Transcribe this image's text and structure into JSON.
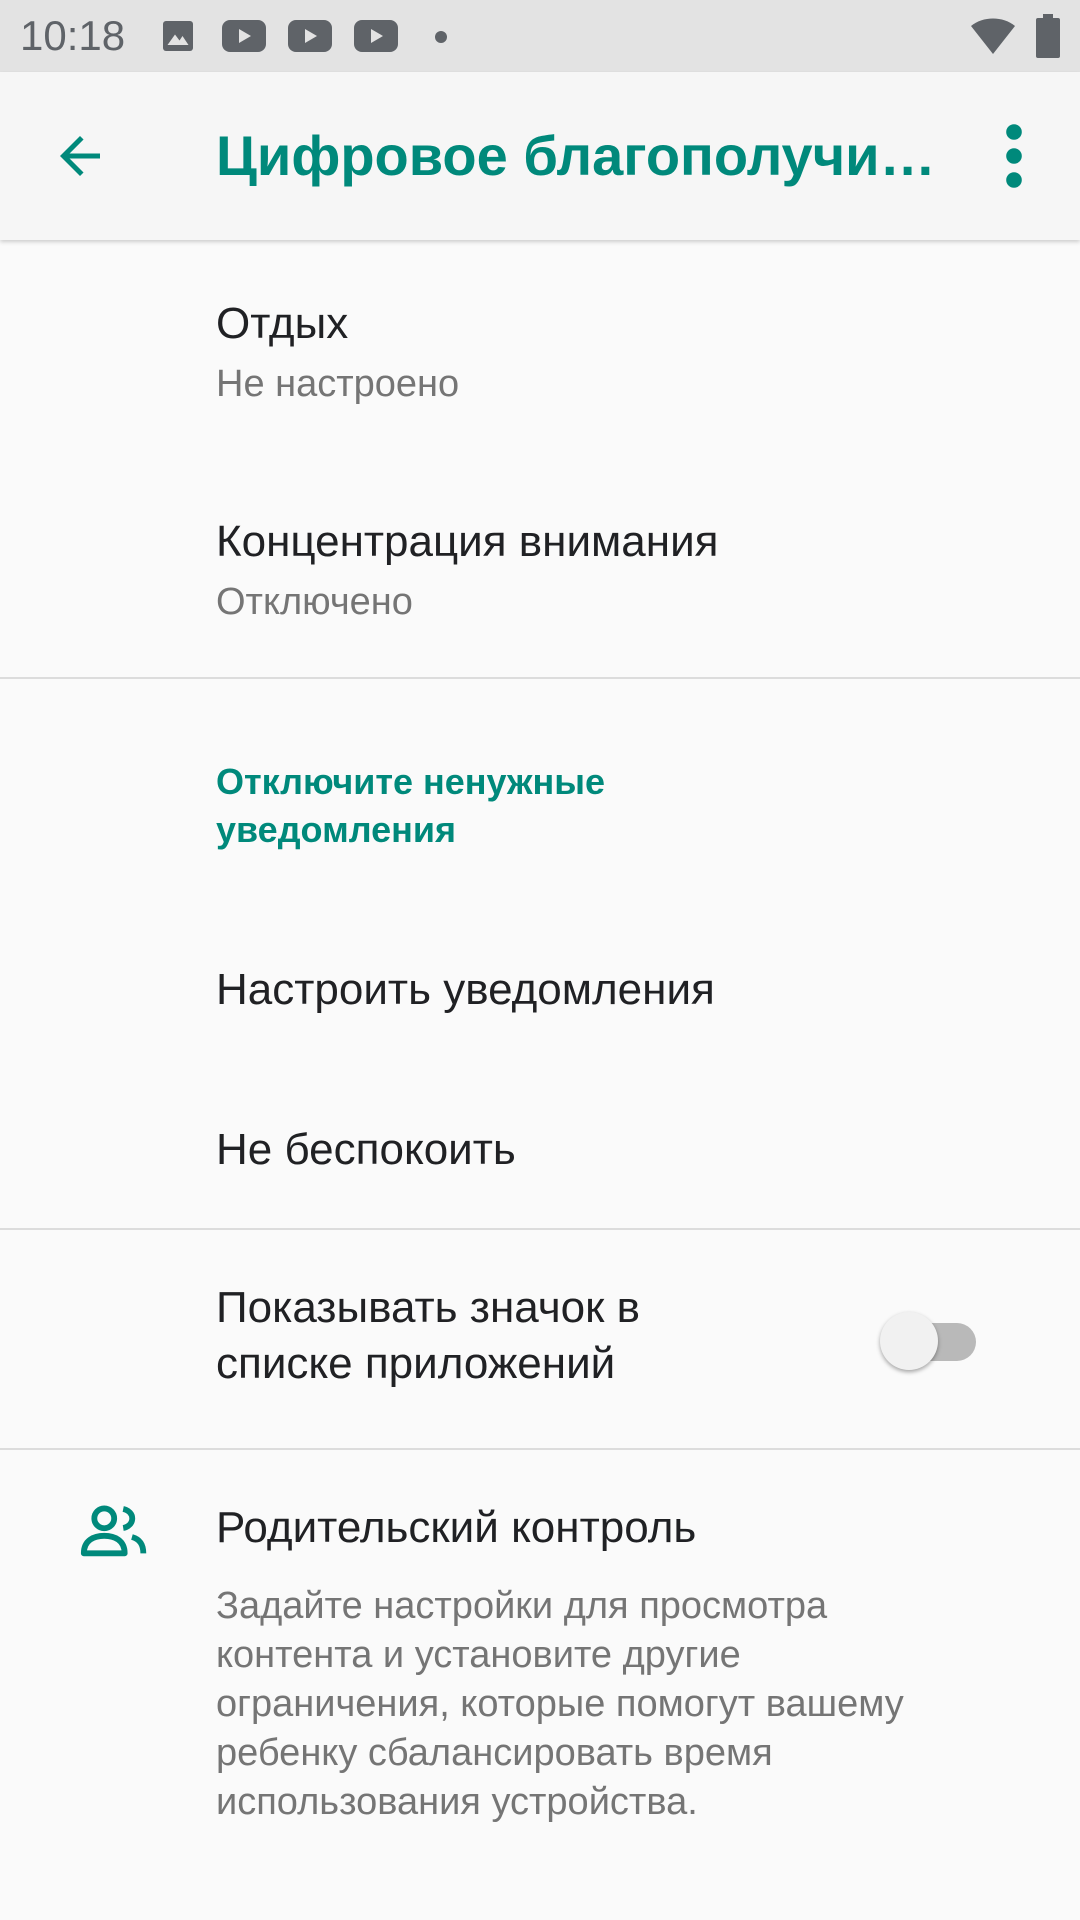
{
  "status_bar": {
    "time": "10:18",
    "icons": [
      "gallery-icon",
      "youtube-icon",
      "youtube-icon",
      "youtube-icon",
      "notification-dot-icon",
      "wifi-icon",
      "battery-icon"
    ]
  },
  "app_bar": {
    "title": "Цифровое благополучи…",
    "back_icon": "arrow-back-icon",
    "menu_icon": "more-vert-icon"
  },
  "items": {
    "wind_down": {
      "title": "Отдых",
      "summary": "Не настроено"
    },
    "focus": {
      "title": "Концентрация внимания",
      "summary": "Отключено"
    },
    "notifications_category": {
      "title_line1": "Отключите ненужные",
      "title_line2": "уведомления"
    },
    "manage_notifications": {
      "title": "Настроить уведомления"
    },
    "do_not_disturb": {
      "title": "Не беспокоить"
    },
    "show_icon": {
      "title_line1": "Показывать значок в",
      "title_line2": "списке приложений",
      "enabled": false
    },
    "parental": {
      "title": "Родительский контроль",
      "icon": "people-icon",
      "summary_lines": [
        "Задайте настройки для просмотра",
        "контента и установите другие",
        "ограничения, которые помогут вашему",
        "ребенку сбалансировать время",
        "использования устройства."
      ]
    }
  },
  "colors": {
    "accent": "#00897b",
    "status_bar_bg": "#e3e3e3",
    "background": "#fafafa",
    "primary_text": "#202124",
    "secondary_text": "#757575"
  }
}
